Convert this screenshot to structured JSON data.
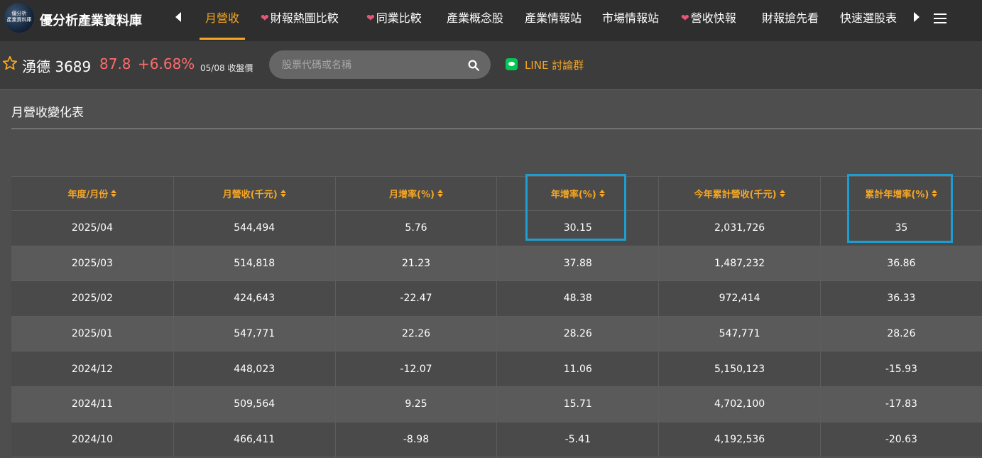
{
  "header": {
    "logo_text": "優分析\n產業資料庫",
    "brand": "優分析產業資料庫",
    "tabs": [
      {
        "label": "月營收",
        "active": true,
        "heart": false
      },
      {
        "label": "財報熱圖比較",
        "active": false,
        "heart": true
      },
      {
        "label": "同業比較",
        "active": false,
        "heart": true
      },
      {
        "label": "產業概念股",
        "active": false,
        "heart": false
      },
      {
        "label": "產業情報站",
        "active": false,
        "heart": false
      },
      {
        "label": "市場情報站",
        "active": false,
        "heart": false
      },
      {
        "label": "營收快報",
        "active": false,
        "heart": true
      },
      {
        "label": "財報搶先看",
        "active": false,
        "heart": false
      },
      {
        "label": "快速選股表",
        "active": false,
        "heart": false
      }
    ]
  },
  "stock": {
    "name": "湧德 3689",
    "price": "87.8",
    "change": "+6.68%",
    "date_label": "05/08 收盤價",
    "price_color": "#ff6b6b"
  },
  "search": {
    "placeholder": "股票代碼或名稱",
    "value": ""
  },
  "line_link": {
    "label": "LINE 討論群"
  },
  "section": {
    "title": "月營收變化表"
  },
  "table": {
    "columns": [
      "年度/月份",
      "月營收(千元)",
      "月增率(%)",
      "年增率(%)",
      "今年累計營收(千元)",
      "累計年增率(%)"
    ],
    "rows": [
      [
        "2025/04",
        "544,494",
        "5.76",
        "30.15",
        "2,031,726",
        "35"
      ],
      [
        "2025/03",
        "514,818",
        "21.23",
        "37.88",
        "1,487,232",
        "36.86"
      ],
      [
        "2025/02",
        "424,643",
        "-22.47",
        "48.38",
        "972,414",
        "36.33"
      ],
      [
        "2025/01",
        "547,771",
        "22.26",
        "28.26",
        "547,771",
        "28.26"
      ],
      [
        "2024/12",
        "448,023",
        "-12.07",
        "11.06",
        "5,150,123",
        "-15.93"
      ],
      [
        "2024/11",
        "509,564",
        "9.25",
        "15.71",
        "4,702,100",
        "-17.83"
      ],
      [
        "2024/10",
        "466,411",
        "-8.98",
        "-5.41",
        "4,192,536",
        "-20.63"
      ]
    ]
  },
  "colors": {
    "accent": "#f5a623",
    "highlight": "#1e9ed0",
    "line_green": "#06c755"
  }
}
